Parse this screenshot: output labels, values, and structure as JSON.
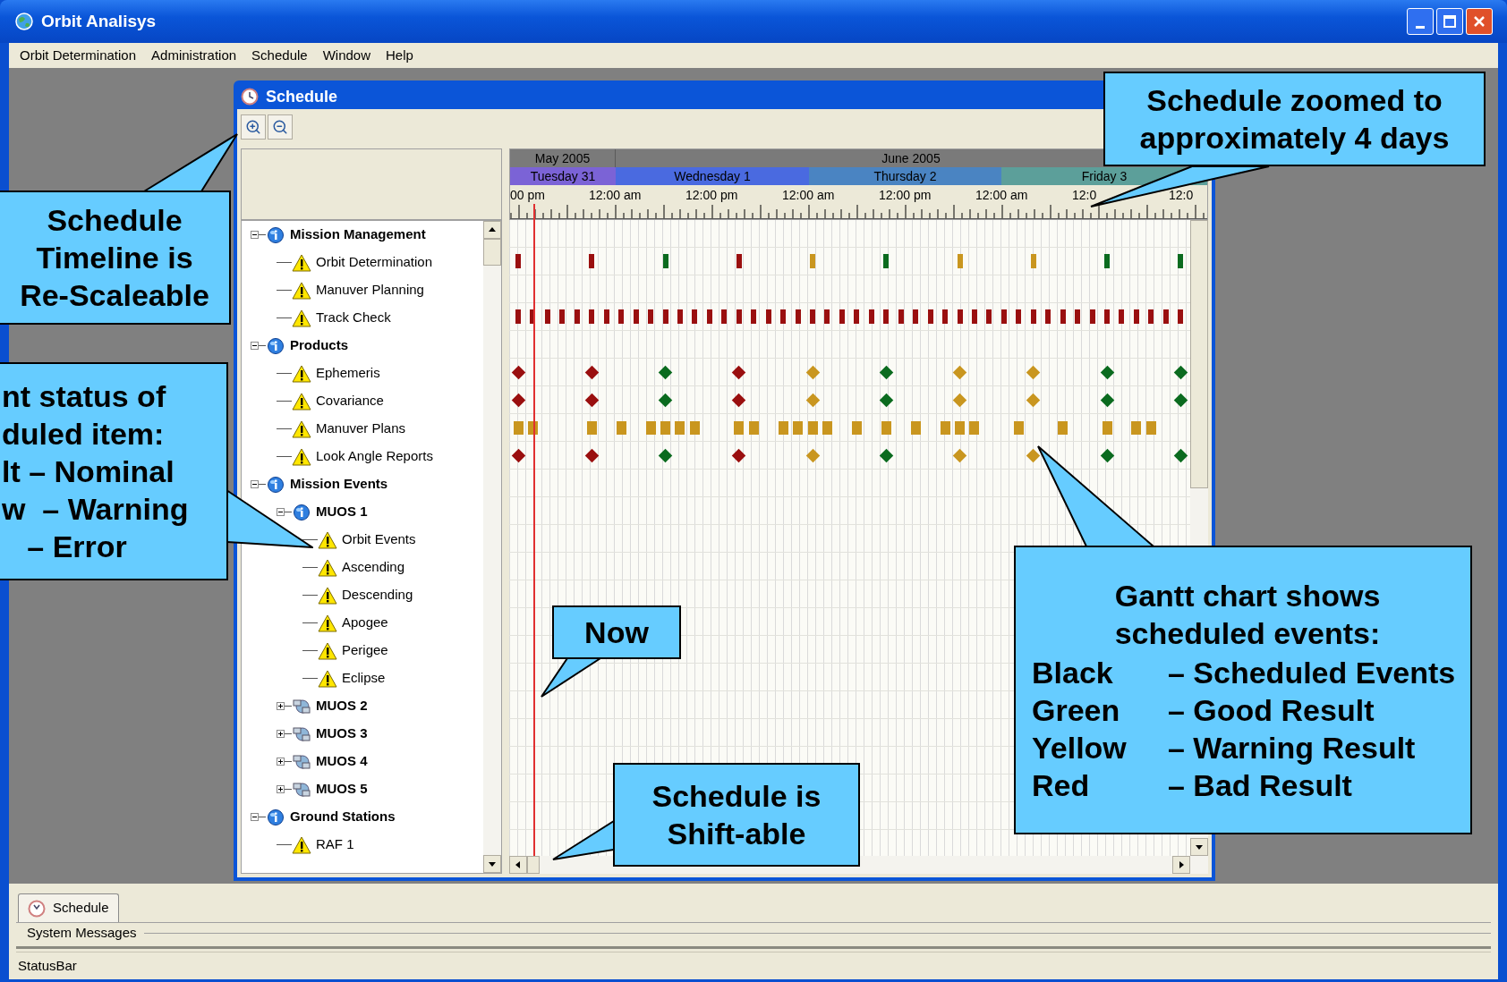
{
  "window": {
    "title": "Orbit Analisys"
  },
  "menu": [
    "Orbit Determination",
    "Administration",
    "Schedule",
    "Window",
    "Help"
  ],
  "schedule_window": {
    "title": "Schedule",
    "timeline": {
      "months": [
        "May 2005",
        "June 2005"
      ],
      "days": [
        {
          "label": "Tuesday 31",
          "color": "#7b63d6"
        },
        {
          "label": "Wednesday 1",
          "color": "#4a6ae0"
        },
        {
          "label": "Thursday 2",
          "color": "#4a84c2"
        },
        {
          "label": "Friday 3",
          "color": "#5c9f9a"
        }
      ],
      "hours": [
        "00 pm",
        "12:00 am",
        "12:00 pm",
        "12:00 am",
        "12:00 pm",
        "12:00 am",
        "12:0",
        "12:0"
      ]
    },
    "tree": [
      {
        "label": "Mission Management",
        "kind": "group",
        "expanded": true,
        "children": [
          {
            "label": "Orbit Determination",
            "kind": "item",
            "events": [
              {
                "kind": "bar",
                "color": "#9a0f0f"
              },
              {
                "kind": "gap"
              },
              {
                "kind": "gap"
              },
              {
                "kind": "gap"
              },
              {
                "kind": "gap"
              },
              {
                "kind": "bar",
                "color": "#9a0f0f"
              },
              {
                "kind": "gap"
              },
              {
                "kind": "gap"
              },
              {
                "kind": "gap"
              },
              {
                "kind": "gap"
              },
              {
                "kind": "bar",
                "color": "#0b6b1f"
              },
              {
                "kind": "gap"
              },
              {
                "kind": "gap"
              },
              {
                "kind": "gap"
              },
              {
                "kind": "gap"
              },
              {
                "kind": "bar",
                "color": "#9a0f0f"
              },
              {
                "kind": "gap"
              },
              {
                "kind": "gap"
              },
              {
                "kind": "gap"
              },
              {
                "kind": "gap"
              },
              {
                "kind": "bar",
                "color": "#c9961f"
              },
              {
                "kind": "gap"
              },
              {
                "kind": "gap"
              },
              {
                "kind": "gap"
              },
              {
                "kind": "gap"
              },
              {
                "kind": "bar",
                "color": "#0b6b1f"
              },
              {
                "kind": "gap"
              },
              {
                "kind": "gap"
              },
              {
                "kind": "gap"
              },
              {
                "kind": "gap"
              },
              {
                "kind": "bar",
                "color": "#c9961f"
              },
              {
                "kind": "gap"
              },
              {
                "kind": "gap"
              },
              {
                "kind": "gap"
              },
              {
                "kind": "gap"
              },
              {
                "kind": "bar",
                "color": "#c9961f"
              },
              {
                "kind": "gap"
              },
              {
                "kind": "gap"
              },
              {
                "kind": "gap"
              },
              {
                "kind": "gap"
              },
              {
                "kind": "bar",
                "color": "#0b6b1f"
              },
              {
                "kind": "gap"
              },
              {
                "kind": "gap"
              },
              {
                "kind": "gap"
              },
              {
                "kind": "gap"
              },
              {
                "kind": "bar",
                "color": "#0b6b1f"
              }
            ]
          },
          {
            "label": "Manuver Planning",
            "kind": "item"
          },
          {
            "label": "Track Check",
            "kind": "item",
            "events": [
              {
                "kind": "bar",
                "color": "#9a0f0f"
              },
              {
                "kind": "bar",
                "color": "#9a0f0f"
              },
              {
                "kind": "bar",
                "color": "#9a0f0f"
              },
              {
                "kind": "bar",
                "color": "#9a0f0f"
              },
              {
                "kind": "bar",
                "color": "#9a0f0f"
              },
              {
                "kind": "bar",
                "color": "#9a0f0f"
              },
              {
                "kind": "bar",
                "color": "#9a0f0f"
              },
              {
                "kind": "bar",
                "color": "#9a0f0f"
              },
              {
                "kind": "bar",
                "color": "#9a0f0f"
              },
              {
                "kind": "bar",
                "color": "#9a0f0f"
              },
              {
                "kind": "bar",
                "color": "#9a0f0f"
              },
              {
                "kind": "bar",
                "color": "#9a0f0f"
              },
              {
                "kind": "bar",
                "color": "#9a0f0f"
              },
              {
                "kind": "bar",
                "color": "#9a0f0f"
              },
              {
                "kind": "bar",
                "color": "#9a0f0f"
              },
              {
                "kind": "bar",
                "color": "#9a0f0f"
              },
              {
                "kind": "bar",
                "color": "#9a0f0f"
              },
              {
                "kind": "bar",
                "color": "#9a0f0f"
              },
              {
                "kind": "bar",
                "color": "#9a0f0f"
              },
              {
                "kind": "bar",
                "color": "#9a0f0f"
              },
              {
                "kind": "bar",
                "color": "#9a0f0f"
              },
              {
                "kind": "bar",
                "color": "#9a0f0f"
              },
              {
                "kind": "bar",
                "color": "#9a0f0f"
              },
              {
                "kind": "bar",
                "color": "#9a0f0f"
              },
              {
                "kind": "bar",
                "color": "#9a0f0f"
              },
              {
                "kind": "bar",
                "color": "#9a0f0f"
              },
              {
                "kind": "bar",
                "color": "#9a0f0f"
              },
              {
                "kind": "bar",
                "color": "#9a0f0f"
              },
              {
                "kind": "bar",
                "color": "#9a0f0f"
              },
              {
                "kind": "bar",
                "color": "#9a0f0f"
              },
              {
                "kind": "bar",
                "color": "#9a0f0f"
              },
              {
                "kind": "bar",
                "color": "#9a0f0f"
              },
              {
                "kind": "bar",
                "color": "#9a0f0f"
              },
              {
                "kind": "bar",
                "color": "#9a0f0f"
              },
              {
                "kind": "bar",
                "color": "#9a0f0f"
              },
              {
                "kind": "bar",
                "color": "#9a0f0f"
              },
              {
                "kind": "bar",
                "color": "#9a0f0f"
              },
              {
                "kind": "bar",
                "color": "#9a0f0f"
              },
              {
                "kind": "bar",
                "color": "#9a0f0f"
              },
              {
                "kind": "bar",
                "color": "#9a0f0f"
              },
              {
                "kind": "bar",
                "color": "#9a0f0f"
              },
              {
                "kind": "bar",
                "color": "#9a0f0f"
              },
              {
                "kind": "bar",
                "color": "#9a0f0f"
              },
              {
                "kind": "bar",
                "color": "#9a0f0f"
              },
              {
                "kind": "bar",
                "color": "#9a0f0f"
              },
              {
                "kind": "bar",
                "color": "#9a0f0f"
              }
            ]
          }
        ]
      },
      {
        "label": "Products",
        "kind": "group",
        "expanded": true,
        "children": [
          {
            "label": "Ephemeris",
            "kind": "item",
            "events": [
              {
                "kind": "diamond",
                "color": "#9a0f0f"
              },
              {
                "kind": "gap"
              },
              {
                "kind": "gap"
              },
              {
                "kind": "gap"
              },
              {
                "kind": "gap"
              },
              {
                "kind": "diamond",
                "color": "#9a0f0f"
              },
              {
                "kind": "gap"
              },
              {
                "kind": "gap"
              },
              {
                "kind": "gap"
              },
              {
                "kind": "gap"
              },
              {
                "kind": "diamond",
                "color": "#0b6b1f"
              },
              {
                "kind": "gap"
              },
              {
                "kind": "gap"
              },
              {
                "kind": "gap"
              },
              {
                "kind": "gap"
              },
              {
                "kind": "diamond",
                "color": "#9a0f0f"
              },
              {
                "kind": "gap"
              },
              {
                "kind": "gap"
              },
              {
                "kind": "gap"
              },
              {
                "kind": "gap"
              },
              {
                "kind": "diamond",
                "color": "#c9961f"
              },
              {
                "kind": "gap"
              },
              {
                "kind": "gap"
              },
              {
                "kind": "gap"
              },
              {
                "kind": "gap"
              },
              {
                "kind": "diamond",
                "color": "#0b6b1f"
              },
              {
                "kind": "gap"
              },
              {
                "kind": "gap"
              },
              {
                "kind": "gap"
              },
              {
                "kind": "gap"
              },
              {
                "kind": "diamond",
                "color": "#c9961f"
              },
              {
                "kind": "gap"
              },
              {
                "kind": "gap"
              },
              {
                "kind": "gap"
              },
              {
                "kind": "gap"
              },
              {
                "kind": "diamond",
                "color": "#c9961f"
              },
              {
                "kind": "gap"
              },
              {
                "kind": "gap"
              },
              {
                "kind": "gap"
              },
              {
                "kind": "gap"
              },
              {
                "kind": "diamond",
                "color": "#0b6b1f"
              },
              {
                "kind": "gap"
              },
              {
                "kind": "gap"
              },
              {
                "kind": "gap"
              },
              {
                "kind": "gap"
              },
              {
                "kind": "diamond",
                "color": "#0b6b1f"
              }
            ]
          },
          {
            "label": "Covariance",
            "kind": "item",
            "events": [
              {
                "kind": "diamond",
                "color": "#9a0f0f"
              },
              {
                "kind": "gap"
              },
              {
                "kind": "gap"
              },
              {
                "kind": "gap"
              },
              {
                "kind": "gap"
              },
              {
                "kind": "diamond",
                "color": "#9a0f0f"
              },
              {
                "kind": "gap"
              },
              {
                "kind": "gap"
              },
              {
                "kind": "gap"
              },
              {
                "kind": "gap"
              },
              {
                "kind": "diamond",
                "color": "#0b6b1f"
              },
              {
                "kind": "gap"
              },
              {
                "kind": "gap"
              },
              {
                "kind": "gap"
              },
              {
                "kind": "gap"
              },
              {
                "kind": "diamond",
                "color": "#9a0f0f"
              },
              {
                "kind": "gap"
              },
              {
                "kind": "gap"
              },
              {
                "kind": "gap"
              },
              {
                "kind": "gap"
              },
              {
                "kind": "diamond",
                "color": "#c9961f"
              },
              {
                "kind": "gap"
              },
              {
                "kind": "gap"
              },
              {
                "kind": "gap"
              },
              {
                "kind": "gap"
              },
              {
                "kind": "diamond",
                "color": "#0b6b1f"
              },
              {
                "kind": "gap"
              },
              {
                "kind": "gap"
              },
              {
                "kind": "gap"
              },
              {
                "kind": "gap"
              },
              {
                "kind": "diamond",
                "color": "#c9961f"
              },
              {
                "kind": "gap"
              },
              {
                "kind": "gap"
              },
              {
                "kind": "gap"
              },
              {
                "kind": "gap"
              },
              {
                "kind": "diamond",
                "color": "#c9961f"
              },
              {
                "kind": "gap"
              },
              {
                "kind": "gap"
              },
              {
                "kind": "gap"
              },
              {
                "kind": "gap"
              },
              {
                "kind": "diamond",
                "color": "#0b6b1f"
              },
              {
                "kind": "gap"
              },
              {
                "kind": "gap"
              },
              {
                "kind": "gap"
              },
              {
                "kind": "gap"
              },
              {
                "kind": "diamond",
                "color": "#0b6b1f"
              }
            ]
          },
          {
            "label": "Manuver Plans",
            "kind": "item",
            "events": [
              {
                "kind": "block",
                "color": "#c9961f"
              },
              {
                "kind": "block",
                "color": "#c9961f"
              },
              {
                "kind": "gap"
              },
              {
                "kind": "gap"
              },
              {
                "kind": "gap"
              },
              {
                "kind": "block",
                "color": "#c9961f"
              },
              {
                "kind": "gap"
              },
              {
                "kind": "block",
                "color": "#c9961f"
              },
              {
                "kind": "gap"
              },
              {
                "kind": "block",
                "color": "#c9961f"
              },
              {
                "kind": "block",
                "color": "#c9961f"
              },
              {
                "kind": "block",
                "color": "#c9961f"
              },
              {
                "kind": "block",
                "color": "#c9961f"
              },
              {
                "kind": "gap"
              },
              {
                "kind": "gap"
              },
              {
                "kind": "block",
                "color": "#c9961f"
              },
              {
                "kind": "block",
                "color": "#c9961f"
              },
              {
                "kind": "gap"
              },
              {
                "kind": "block",
                "color": "#c9961f"
              },
              {
                "kind": "block",
                "color": "#c9961f"
              },
              {
                "kind": "block",
                "color": "#c9961f"
              },
              {
                "kind": "block",
                "color": "#c9961f"
              },
              {
                "kind": "gap"
              },
              {
                "kind": "block",
                "color": "#c9961f"
              },
              {
                "kind": "gap"
              },
              {
                "kind": "block",
                "color": "#c9961f"
              },
              {
                "kind": "gap"
              },
              {
                "kind": "block",
                "color": "#c9961f"
              },
              {
                "kind": "gap"
              },
              {
                "kind": "block",
                "color": "#c9961f"
              },
              {
                "kind": "block",
                "color": "#c9961f"
              },
              {
                "kind": "block",
                "color": "#c9961f"
              },
              {
                "kind": "gap"
              },
              {
                "kind": "gap"
              },
              {
                "kind": "block",
                "color": "#c9961f"
              },
              {
                "kind": "gap"
              },
              {
                "kind": "gap"
              },
              {
                "kind": "block",
                "color": "#c9961f"
              },
              {
                "kind": "gap"
              },
              {
                "kind": "gap"
              },
              {
                "kind": "block",
                "color": "#c9961f"
              },
              {
                "kind": "gap"
              },
              {
                "kind": "block",
                "color": "#c9961f"
              },
              {
                "kind": "block",
                "color": "#c9961f"
              }
            ]
          },
          {
            "label": "Look Angle Reports",
            "kind": "item",
            "events": [
              {
                "kind": "diamond",
                "color": "#9a0f0f"
              },
              {
                "kind": "gap"
              },
              {
                "kind": "gap"
              },
              {
                "kind": "gap"
              },
              {
                "kind": "gap"
              },
              {
                "kind": "diamond",
                "color": "#9a0f0f"
              },
              {
                "kind": "gap"
              },
              {
                "kind": "gap"
              },
              {
                "kind": "gap"
              },
              {
                "kind": "gap"
              },
              {
                "kind": "diamond",
                "color": "#0b6b1f"
              },
              {
                "kind": "gap"
              },
              {
                "kind": "gap"
              },
              {
                "kind": "gap"
              },
              {
                "kind": "gap"
              },
              {
                "kind": "diamond",
                "color": "#9a0f0f"
              },
              {
                "kind": "gap"
              },
              {
                "kind": "gap"
              },
              {
                "kind": "gap"
              },
              {
                "kind": "gap"
              },
              {
                "kind": "diamond",
                "color": "#c9961f"
              },
              {
                "kind": "gap"
              },
              {
                "kind": "gap"
              },
              {
                "kind": "gap"
              },
              {
                "kind": "gap"
              },
              {
                "kind": "diamond",
                "color": "#0b6b1f"
              },
              {
                "kind": "gap"
              },
              {
                "kind": "gap"
              },
              {
                "kind": "gap"
              },
              {
                "kind": "gap"
              },
              {
                "kind": "diamond",
                "color": "#c9961f"
              },
              {
                "kind": "gap"
              },
              {
                "kind": "gap"
              },
              {
                "kind": "gap"
              },
              {
                "kind": "gap"
              },
              {
                "kind": "diamond",
                "color": "#c9961f"
              },
              {
                "kind": "gap"
              },
              {
                "kind": "gap"
              },
              {
                "kind": "gap"
              },
              {
                "kind": "gap"
              },
              {
                "kind": "diamond",
                "color": "#0b6b1f"
              },
              {
                "kind": "gap"
              },
              {
                "kind": "gap"
              },
              {
                "kind": "gap"
              },
              {
                "kind": "gap"
              },
              {
                "kind": "diamond",
                "color": "#0b6b1f"
              }
            ]
          }
        ]
      },
      {
        "label": "Mission Events",
        "kind": "group",
        "expanded": true,
        "children": [
          {
            "label": "MUOS 1",
            "kind": "group",
            "expanded": true,
            "children": [
              {
                "label": "Orbit Events",
                "kind": "item"
              },
              {
                "label": "Ascending",
                "kind": "item"
              },
              {
                "label": "Descending",
                "kind": "item"
              },
              {
                "label": "Apogee",
                "kind": "item"
              },
              {
                "label": "Perigee",
                "kind": "item"
              },
              {
                "label": "Eclipse",
                "kind": "item"
              }
            ]
          },
          {
            "label": "MUOS 2",
            "kind": "group",
            "expanded": false
          },
          {
            "label": "MUOS 3",
            "kind": "group",
            "expanded": false
          },
          {
            "label": "MUOS 4",
            "kind": "group",
            "expanded": false
          },
          {
            "label": "MUOS 5",
            "kind": "group",
            "expanded": false
          }
        ]
      },
      {
        "label": "Ground Stations",
        "kind": "group",
        "expanded": true,
        "children": [
          {
            "label": "RAF 1",
            "kind": "item"
          }
        ]
      }
    ]
  },
  "taskbar_tab": {
    "label": "Schedule"
  },
  "system_messages": {
    "title": "System Messages"
  },
  "status_bar": {
    "text": "StatusBar"
  },
  "callouts": [
    {
      "lines": [
        "Schedule zoomed to",
        "approximately 4 days"
      ]
    },
    {
      "lines": [
        "Schedule",
        "Timeline is",
        "Re-Scaleable"
      ]
    },
    {
      "lines": [
        "nt status of",
        "duled item:",
        "lt – Nominal",
        "w  – Warning",
        "   – Error"
      ]
    },
    {
      "lines": [
        "Now"
      ]
    },
    {
      "lines": [
        "Schedule is",
        "Shift-able"
      ]
    },
    {
      "lines": [
        "Gantt chart shows",
        "scheduled events:"
      ],
      "legend": [
        {
          "term": "Black",
          "meaning": "– Scheduled Events"
        },
        {
          "term": "Green",
          "meaning": "– Good Result"
        },
        {
          "term": "Yellow",
          "meaning": "– Warning Result"
        },
        {
          "term": "Red",
          "meaning": "– Bad Result"
        }
      ]
    }
  ]
}
